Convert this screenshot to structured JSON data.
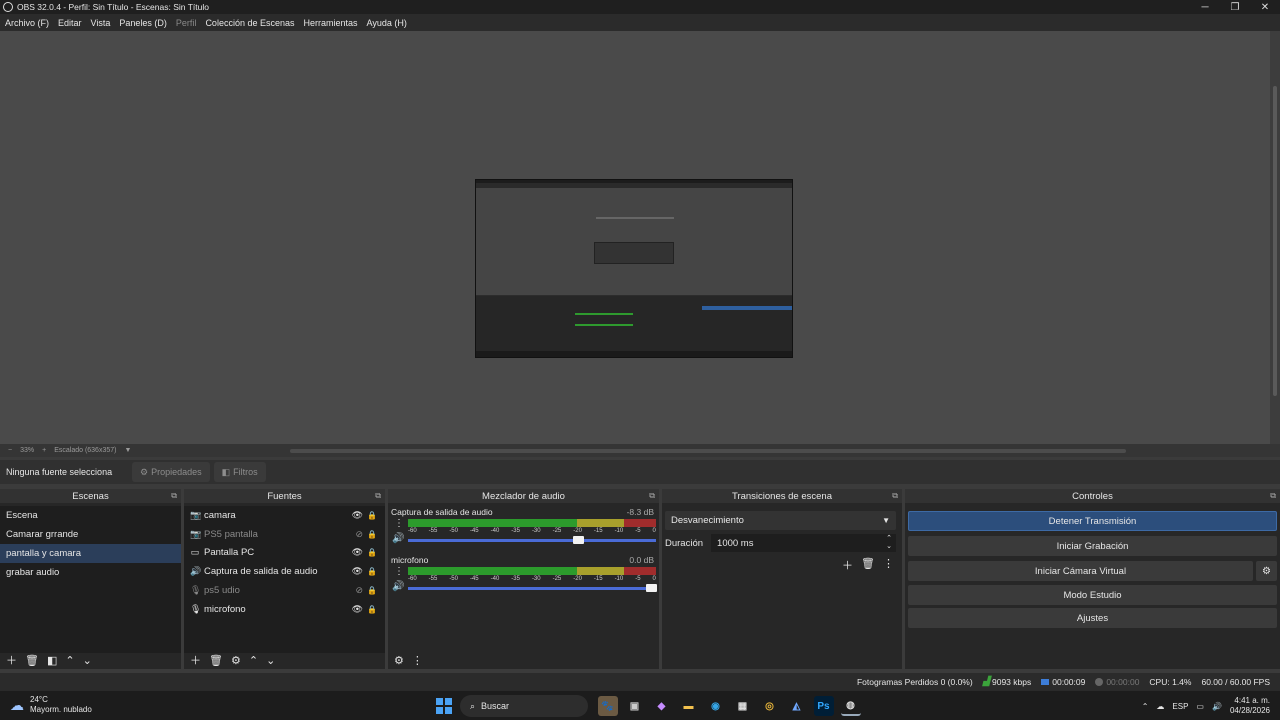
{
  "window": {
    "title": "OBS 32.0.4 - Perfil: Sin Título - Escenas: Sin Título",
    "minimize": "─",
    "maximize": "❐",
    "close": "✕"
  },
  "menu": {
    "items": [
      "Archivo (F)",
      "Editar",
      "Vista",
      "Paneles (D)",
      "Perfil",
      "Colección de Escenas",
      "Herramientas",
      "Ayuda (H)"
    ]
  },
  "zoom": {
    "minus": "−",
    "level": "33%",
    "plus": "+",
    "mode": "Escalado (636x357)",
    "caret": "▼"
  },
  "context": {
    "no_source": "Ninguna fuente selecciona",
    "properties": "Propiedades",
    "filters": "Filtros"
  },
  "scenes": {
    "title": "Escenas",
    "items": [
      "Escena",
      "Camarar grrande",
      "pantalla y camara",
      "grabar audio"
    ],
    "selected_index": 2
  },
  "sources": {
    "title": "Fuentes",
    "items": [
      {
        "label": "camara",
        "icon": "camera-icon",
        "visible": true
      },
      {
        "label": "PS5 pantalla",
        "icon": "camera-icon",
        "visible": false
      },
      {
        "label": "Pantalla PC",
        "icon": "monitor-icon",
        "visible": true
      },
      {
        "label": "Captura de salida de audio",
        "icon": "speaker-icon",
        "visible": true
      },
      {
        "label": "ps5 udio",
        "icon": "microphone-icon",
        "visible": false
      },
      {
        "label": "microfono",
        "icon": "microphone-icon",
        "visible": true
      }
    ]
  },
  "mixer": {
    "title": "Mezclador de audio",
    "channels": [
      {
        "name": "Captura de salida de audio",
        "db": "-8.3 dB",
        "volume": 0.69
      },
      {
        "name": "microfono",
        "db": "0.0 dB",
        "volume": 1.0
      }
    ],
    "ticks": [
      "-60",
      "-55",
      "-50",
      "-45",
      "-40",
      "-35",
      "-30",
      "-25",
      "-20",
      "-15",
      "-10",
      "-5",
      "0"
    ]
  },
  "transitions": {
    "title": "Transiciones de escena",
    "selected": "Desvanecimiento",
    "duration_label": "Duración",
    "duration_value": "1000 ms"
  },
  "controls": {
    "title": "Controles",
    "stop_stream": "Detener Transmisión",
    "start_recording": "Iniciar Grabación",
    "start_virtual_cam": "Iniciar Cámara Virtual",
    "studio_mode": "Modo Estudio",
    "settings": "Ajustes"
  },
  "status": {
    "dropped_frames": "Fotogramas Perdidos 0 (0.0%)",
    "bitrate": "9093 kbps",
    "stream_time": "00:00:09",
    "record_time": "00:00:00",
    "cpu": "CPU: 1.4%",
    "fps": "60.00 / 60.00 FPS"
  },
  "taskbar": {
    "temperature": "24°C",
    "weather": "Mayorm. nublado",
    "search_placeholder": "Buscar",
    "language": "ESP",
    "time": "4:41 a. m.",
    "date": "04/28/2026"
  },
  "colors": {
    "accent": "#2c4e7c",
    "meter_green": "#2c9b2c",
    "meter_yellow": "#a8a02c",
    "meter_red": "#a02c2c",
    "selection": "#2b3e5a"
  }
}
